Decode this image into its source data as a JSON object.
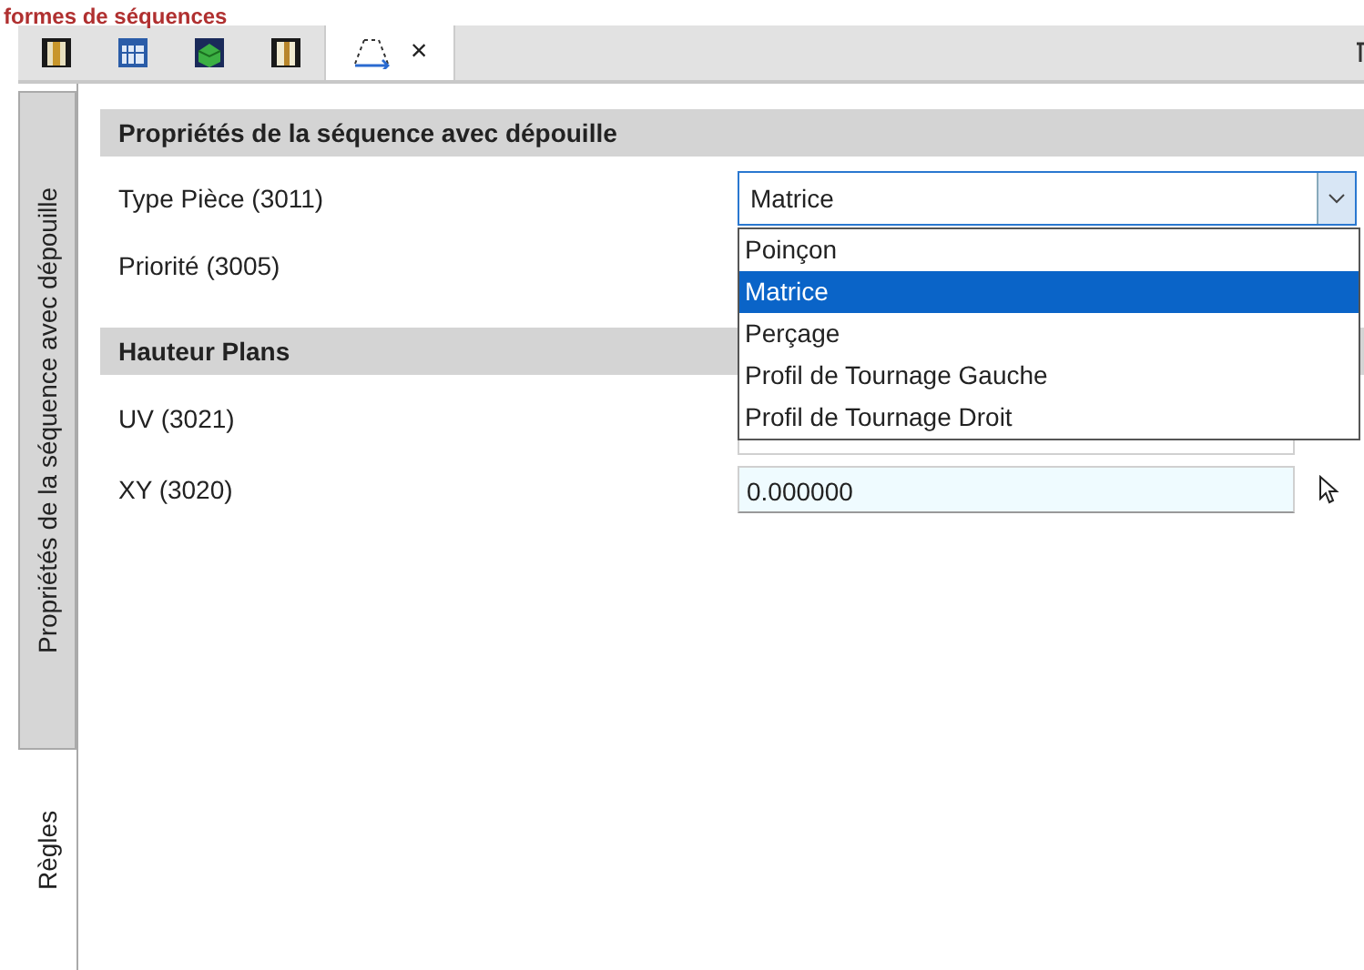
{
  "heading": "formes de séquences",
  "toolbar_tabs": [
    {
      "kind": "icon",
      "selected": false
    },
    {
      "kind": "icon",
      "selected": false
    },
    {
      "kind": "icon",
      "selected": false
    },
    {
      "kind": "icon",
      "selected": false
    },
    {
      "kind": "closable",
      "selected": true,
      "close": "×"
    }
  ],
  "side_tabs": [
    {
      "label": "Propriétés de la séquence avec dépouille",
      "selected": true
    },
    {
      "label": "Règles",
      "selected": false
    }
  ],
  "sections": [
    {
      "title": "Propriétés de la séquence avec dépouille",
      "rows": [
        {
          "label": "Type Pièce (3011)",
          "kind": "combo",
          "value": "Matrice",
          "expanded": true,
          "options": [
            {
              "label": "Poinçon",
              "selected": false
            },
            {
              "label": "Matrice",
              "selected": true
            },
            {
              "label": "Perçage",
              "selected": false
            },
            {
              "label": "Profil de Tournage Gauche",
              "selected": false
            },
            {
              "label": "Profil de Tournage Droit",
              "selected": false
            }
          ]
        },
        {
          "label": "Priorité (3005)",
          "kind": "hidden"
        }
      ]
    },
    {
      "title": "Hauteur Plans",
      "rows": [
        {
          "label": "UV (3021)",
          "kind": "field"
        },
        {
          "label": "XY (3020)",
          "kind": "field",
          "value": "0.000000",
          "focused": true
        }
      ]
    }
  ]
}
